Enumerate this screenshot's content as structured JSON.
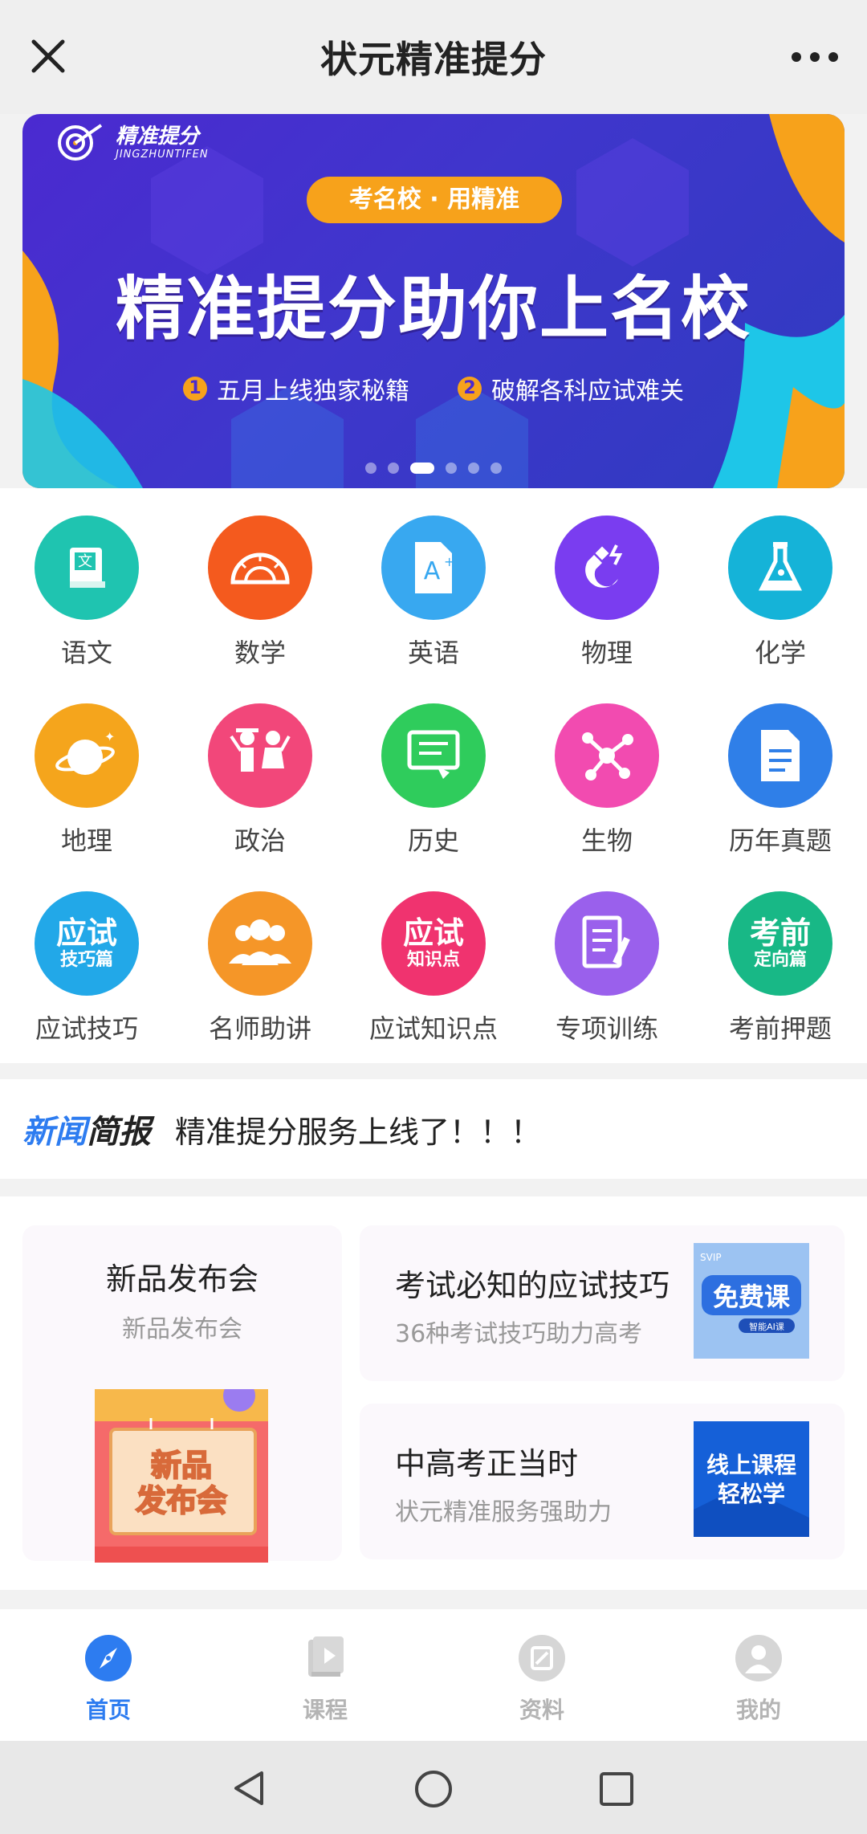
{
  "topbar": {
    "title": "状元精准提分"
  },
  "banner": {
    "logo_cn": "精准提分",
    "logo_en": "JINGZHUNTIFEN",
    "pill": "考名校 · 用精准",
    "headline": "精准提分助你上名校",
    "points": [
      {
        "num": "1",
        "text": "五月上线独家秘籍"
      },
      {
        "num": "2",
        "text": "破解各科应试难关"
      }
    ],
    "active_slide": 3,
    "slide_count": 6
  },
  "grid": [
    {
      "label": "语文",
      "icon": "book-icon",
      "color": "#1fc4b0"
    },
    {
      "label": "数学",
      "icon": "protractor-icon",
      "color": "#f45a1e"
    },
    {
      "label": "英语",
      "icon": "english-doc-icon",
      "color": "#38a8f0"
    },
    {
      "label": "物理",
      "icon": "magnet-icon",
      "color": "#7a3df0"
    },
    {
      "label": "化学",
      "icon": "flask-icon",
      "color": "#15b3d8"
    },
    {
      "label": "地理",
      "icon": "planet-icon",
      "color": "#f5a51c"
    },
    {
      "label": "政治",
      "icon": "people-icon",
      "color": "#f2477a"
    },
    {
      "label": "历史",
      "icon": "board-icon",
      "color": "#2fcc5c"
    },
    {
      "label": "生物",
      "icon": "molecule-icon",
      "color": "#f24bb0"
    },
    {
      "label": "历年真题",
      "icon": "document-icon",
      "color": "#2f7fe8"
    },
    {
      "label": "应试技巧",
      "icon": "tips-badge-icon",
      "color": "#22a8e8",
      "badge": [
        "应试",
        "技巧篇"
      ]
    },
    {
      "label": "名师助讲",
      "icon": "teachers-icon",
      "color": "#f59628"
    },
    {
      "label": "应试知识点",
      "icon": "knowledge-badge-icon",
      "color": "#f0336f",
      "badge": [
        "应试",
        "知识点"
      ]
    },
    {
      "label": "专项训练",
      "icon": "notebook-icon",
      "color": "#9a60ec"
    },
    {
      "label": "考前押题",
      "icon": "exam-badge-icon",
      "color": "#18b886",
      "badge": [
        "考前",
        "定向篇"
      ]
    }
  ],
  "news": {
    "tag_a": "新闻",
    "tag_b": "简报",
    "text": "精准提分服务上线了！！！"
  },
  "promo": {
    "left": {
      "title": "新品发布会",
      "subtitle": "新品发布会",
      "image_text": [
        "新品",
        "发布会"
      ]
    },
    "right": [
      {
        "title": "考试必知的应试技巧",
        "subtitle": "36种考试技巧助力高考",
        "thumb_text": "免费课",
        "thumb_sub": "智能AI课",
        "thumb_badge": "SVIP"
      },
      {
        "title": "中高考正当时",
        "subtitle": "状元精准服务强助力",
        "thumb_text": [
          "线上课程",
          "轻松学"
        ]
      }
    ]
  },
  "bottomnav": [
    {
      "label": "首页",
      "icon": "compass-icon",
      "active": true
    },
    {
      "label": "课程",
      "icon": "course-icon",
      "active": false
    },
    {
      "label": "资料",
      "icon": "materials-icon",
      "active": false
    },
    {
      "label": "我的",
      "icon": "profile-icon",
      "active": false
    }
  ],
  "colors": {
    "accent": "#2d7cf0",
    "banner_orange": "#f7a21b",
    "banner_purple": "#4b2ad0"
  }
}
